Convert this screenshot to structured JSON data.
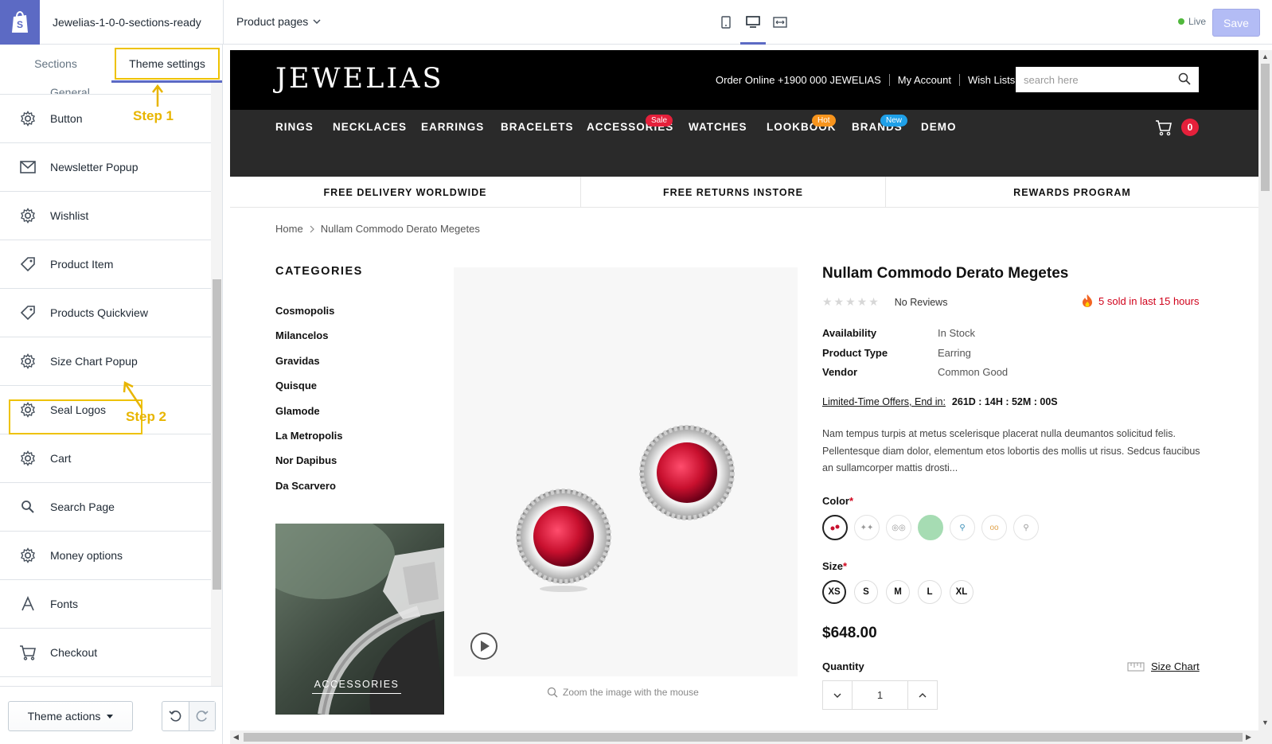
{
  "topbar": {
    "theme_name": "Jewelias-1-0-0-sections-ready",
    "page_select": "Product pages",
    "live_label": "Live",
    "save_label": "Save"
  },
  "sidebar": {
    "tabs": [
      {
        "label": "Sections"
      },
      {
        "label": "Theme settings"
      }
    ],
    "partial_item": "General",
    "items": [
      {
        "label": "Button",
        "icon": "gear-icon"
      },
      {
        "label": "Newsletter Popup",
        "icon": "envelope-icon"
      },
      {
        "label": "Wishlist",
        "icon": "gear-icon"
      },
      {
        "label": "Product Item",
        "icon": "tag-icon"
      },
      {
        "label": "Products Quickview",
        "icon": "tag-icon"
      },
      {
        "label": "Size Chart Popup",
        "icon": "gear-icon"
      },
      {
        "label": "Seal Logos",
        "icon": "gear-icon"
      },
      {
        "label": "Cart",
        "icon": "gear-icon"
      },
      {
        "label": "Search Page",
        "icon": "search-icon"
      },
      {
        "label": "Money options",
        "icon": "gear-icon"
      },
      {
        "label": "Fonts",
        "icon": "font-icon"
      },
      {
        "label": "Checkout",
        "icon": "cart-icon"
      }
    ],
    "step1": "Step 1",
    "step2": "Step 2",
    "theme_actions": "Theme actions"
  },
  "store": {
    "logo": "JEWELIAS",
    "header_links": [
      "Order Online +1900 000 JEWELIAS",
      "My Account",
      "Wish Lists"
    ],
    "search_placeholder": "search here",
    "nav": [
      {
        "label": "RINGS"
      },
      {
        "label": "NECKLACES"
      },
      {
        "label": "EARRINGS"
      },
      {
        "label": "BRACELETS"
      },
      {
        "label": "ACCESSORIES",
        "badge": "Sale",
        "badge_color": "#e5203b"
      },
      {
        "label": "WATCHES"
      },
      {
        "label": "LOOKBOOK",
        "badge": "Hot",
        "badge_color": "#f7941d"
      },
      {
        "label": "BRANDS",
        "badge": "New",
        "badge_color": "#1fa0e8"
      },
      {
        "label": "DEMO"
      }
    ],
    "cart_count": "0",
    "promos": [
      "FREE DELIVERY WORLDWIDE",
      "FREE RETURNS INSTORE",
      "REWARDS PROGRAM"
    ],
    "breadcrumb": {
      "home": "Home",
      "current": "Nullam Commodo Derato Megetes"
    },
    "categories_title": "CATEGORIES",
    "categories": [
      "Cosmopolis",
      "Milancelos",
      "Gravidas",
      "Quisque",
      "Glamode",
      "La Metropolis",
      "Nor Dapibus",
      "Da Scarvero"
    ],
    "banner_label": "ACCESSORIES",
    "zoom_note": "Zoom the image with the mouse"
  },
  "product": {
    "title": "Nullam Commodo Derato Megetes",
    "reviews": "No Reviews",
    "sold": "5 sold in last 15 hours",
    "specs": [
      {
        "k": "Availability",
        "v": "In Stock"
      },
      {
        "k": "Product Type",
        "v": "Earring"
      },
      {
        "k": "Vendor",
        "v": "Common Good"
      }
    ],
    "countdown_label": "Limited-Time Offers, End in:",
    "countdown_value": "261D : 14H : 52M : 00S",
    "description": "Nam tempus turpis at metus scelerisque placerat nulla deumantos solicitud felis. Pellentesque diam dolor, elementum etos lobortis des mollis ut risus. Sedcus faucibus an sullamcorper mattis drosti...",
    "color_label": "Color",
    "size_label": "Size",
    "sizes": [
      "XS",
      "S",
      "M",
      "L",
      "XL"
    ],
    "price": "$648.00",
    "quantity_label": "Quantity",
    "quantity_value": "1",
    "size_chart": "Size Chart"
  }
}
